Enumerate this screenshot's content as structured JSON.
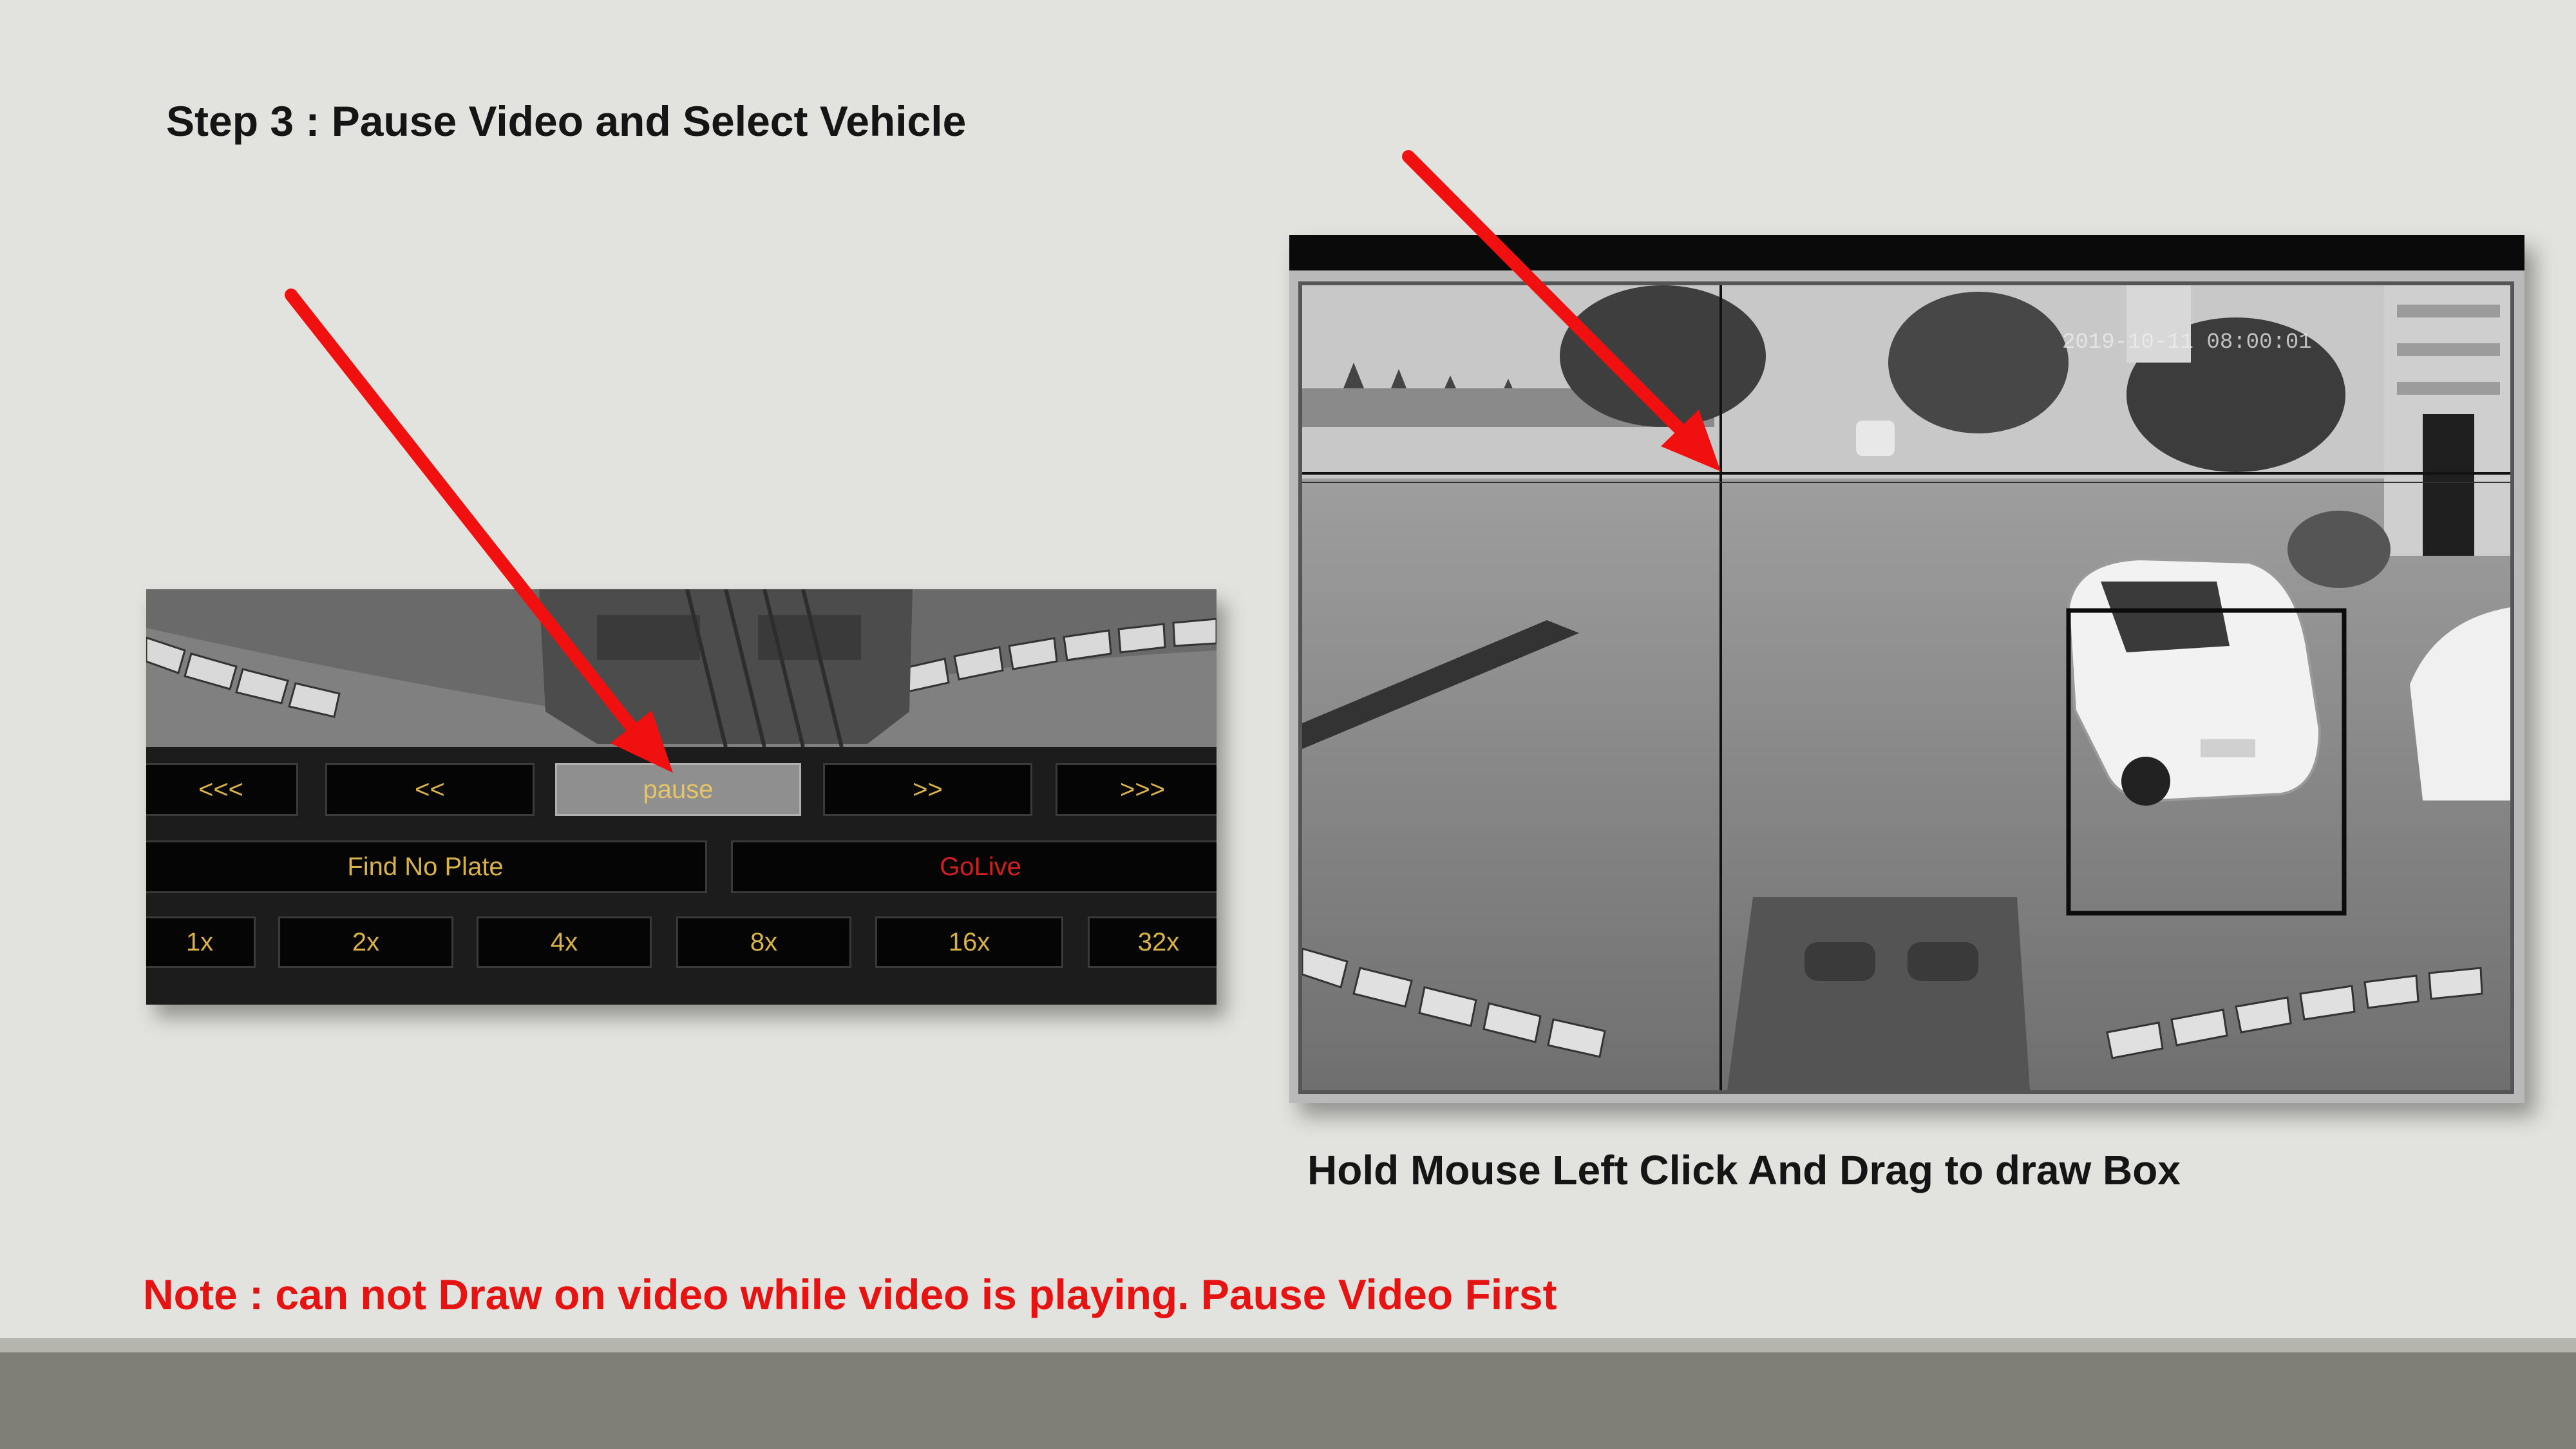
{
  "slide": {
    "title": "Step 3 : Pause Video and Select Vehicle",
    "caption": "Hold Mouse Left Click And Drag to draw Box",
    "note": "Note : can not Draw on video while video is playing. Pause Video First"
  },
  "controls": {
    "row1": [
      "<<<",
      "<<",
      "pause",
      ">>",
      ">>>"
    ],
    "row2": [
      "Find No Plate",
      "GoLive"
    ],
    "row3": [
      "1x",
      "2x",
      "4x",
      "8x",
      "16x",
      "32x"
    ],
    "active_button": "pause"
  },
  "video": {
    "timestamp": "2019-10-11 08:00:01"
  },
  "colors": {
    "arrow": "#f01010",
    "note_text": "#e51413",
    "button_text": "#d9b24c",
    "golive_text": "#d11f1f",
    "background": "#e2e2de"
  },
  "icons": {
    "arrow": "red-arrow-annotation"
  }
}
